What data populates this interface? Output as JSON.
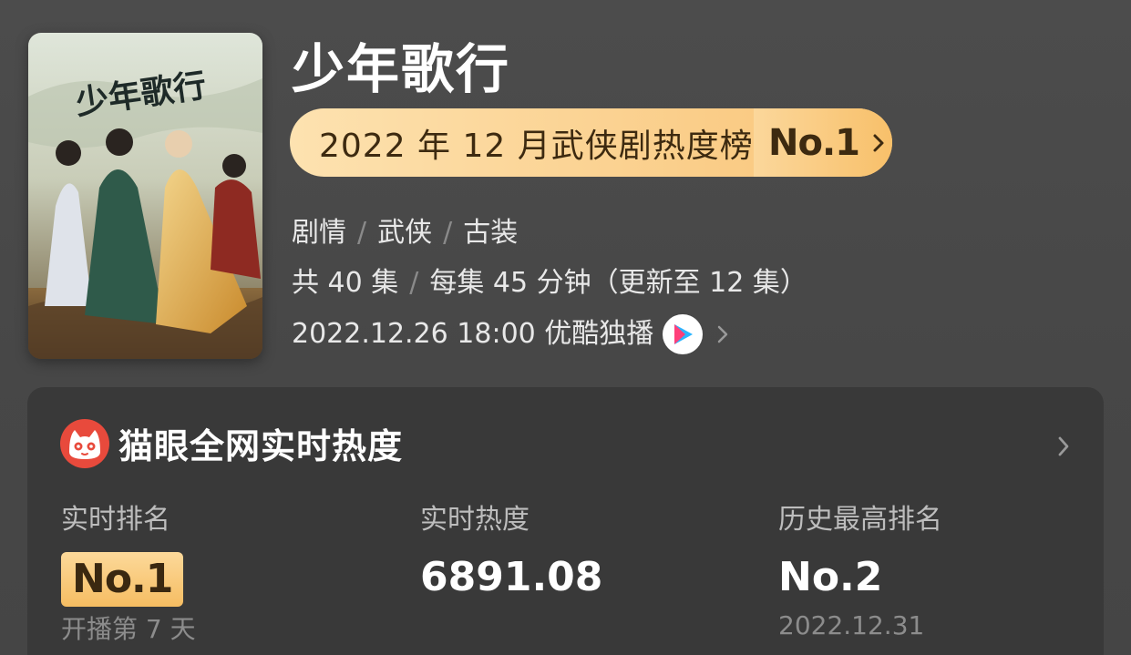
{
  "poster": {
    "calligraphy": "少年歌行"
  },
  "title": "少年歌行",
  "rank_banner": {
    "label": "2022 年 12 月武侠剧热度榜",
    "rank": "No.1"
  },
  "tags": [
    "剧情",
    "武侠",
    "古装"
  ],
  "episodes": {
    "total": "共 40 集",
    "detail": "每集 45 分钟（更新至 12 集）"
  },
  "release": {
    "text": "2022.12.26 18:00 优酷独播",
    "platform_icon": "youku-icon"
  },
  "heat_card": {
    "title": "猫眼全网实时热度",
    "icon": "maoyan-cat-icon",
    "stats": [
      {
        "label": "实时排名",
        "value": "No.1",
        "sub": "开播第 7 天"
      },
      {
        "label": "实时热度",
        "value": "6891.08",
        "sub": ""
      },
      {
        "label": "历史最高排名",
        "value": "No.2",
        "sub": "2022.12.31"
      }
    ]
  },
  "colors": {
    "background": "#4a4a4a",
    "card": "#393939",
    "gold_light": "#fde2b0",
    "gold_dark": "#f8c06a",
    "gold_text": "#3d2a10",
    "maoyan_red": "#e84a3c"
  }
}
